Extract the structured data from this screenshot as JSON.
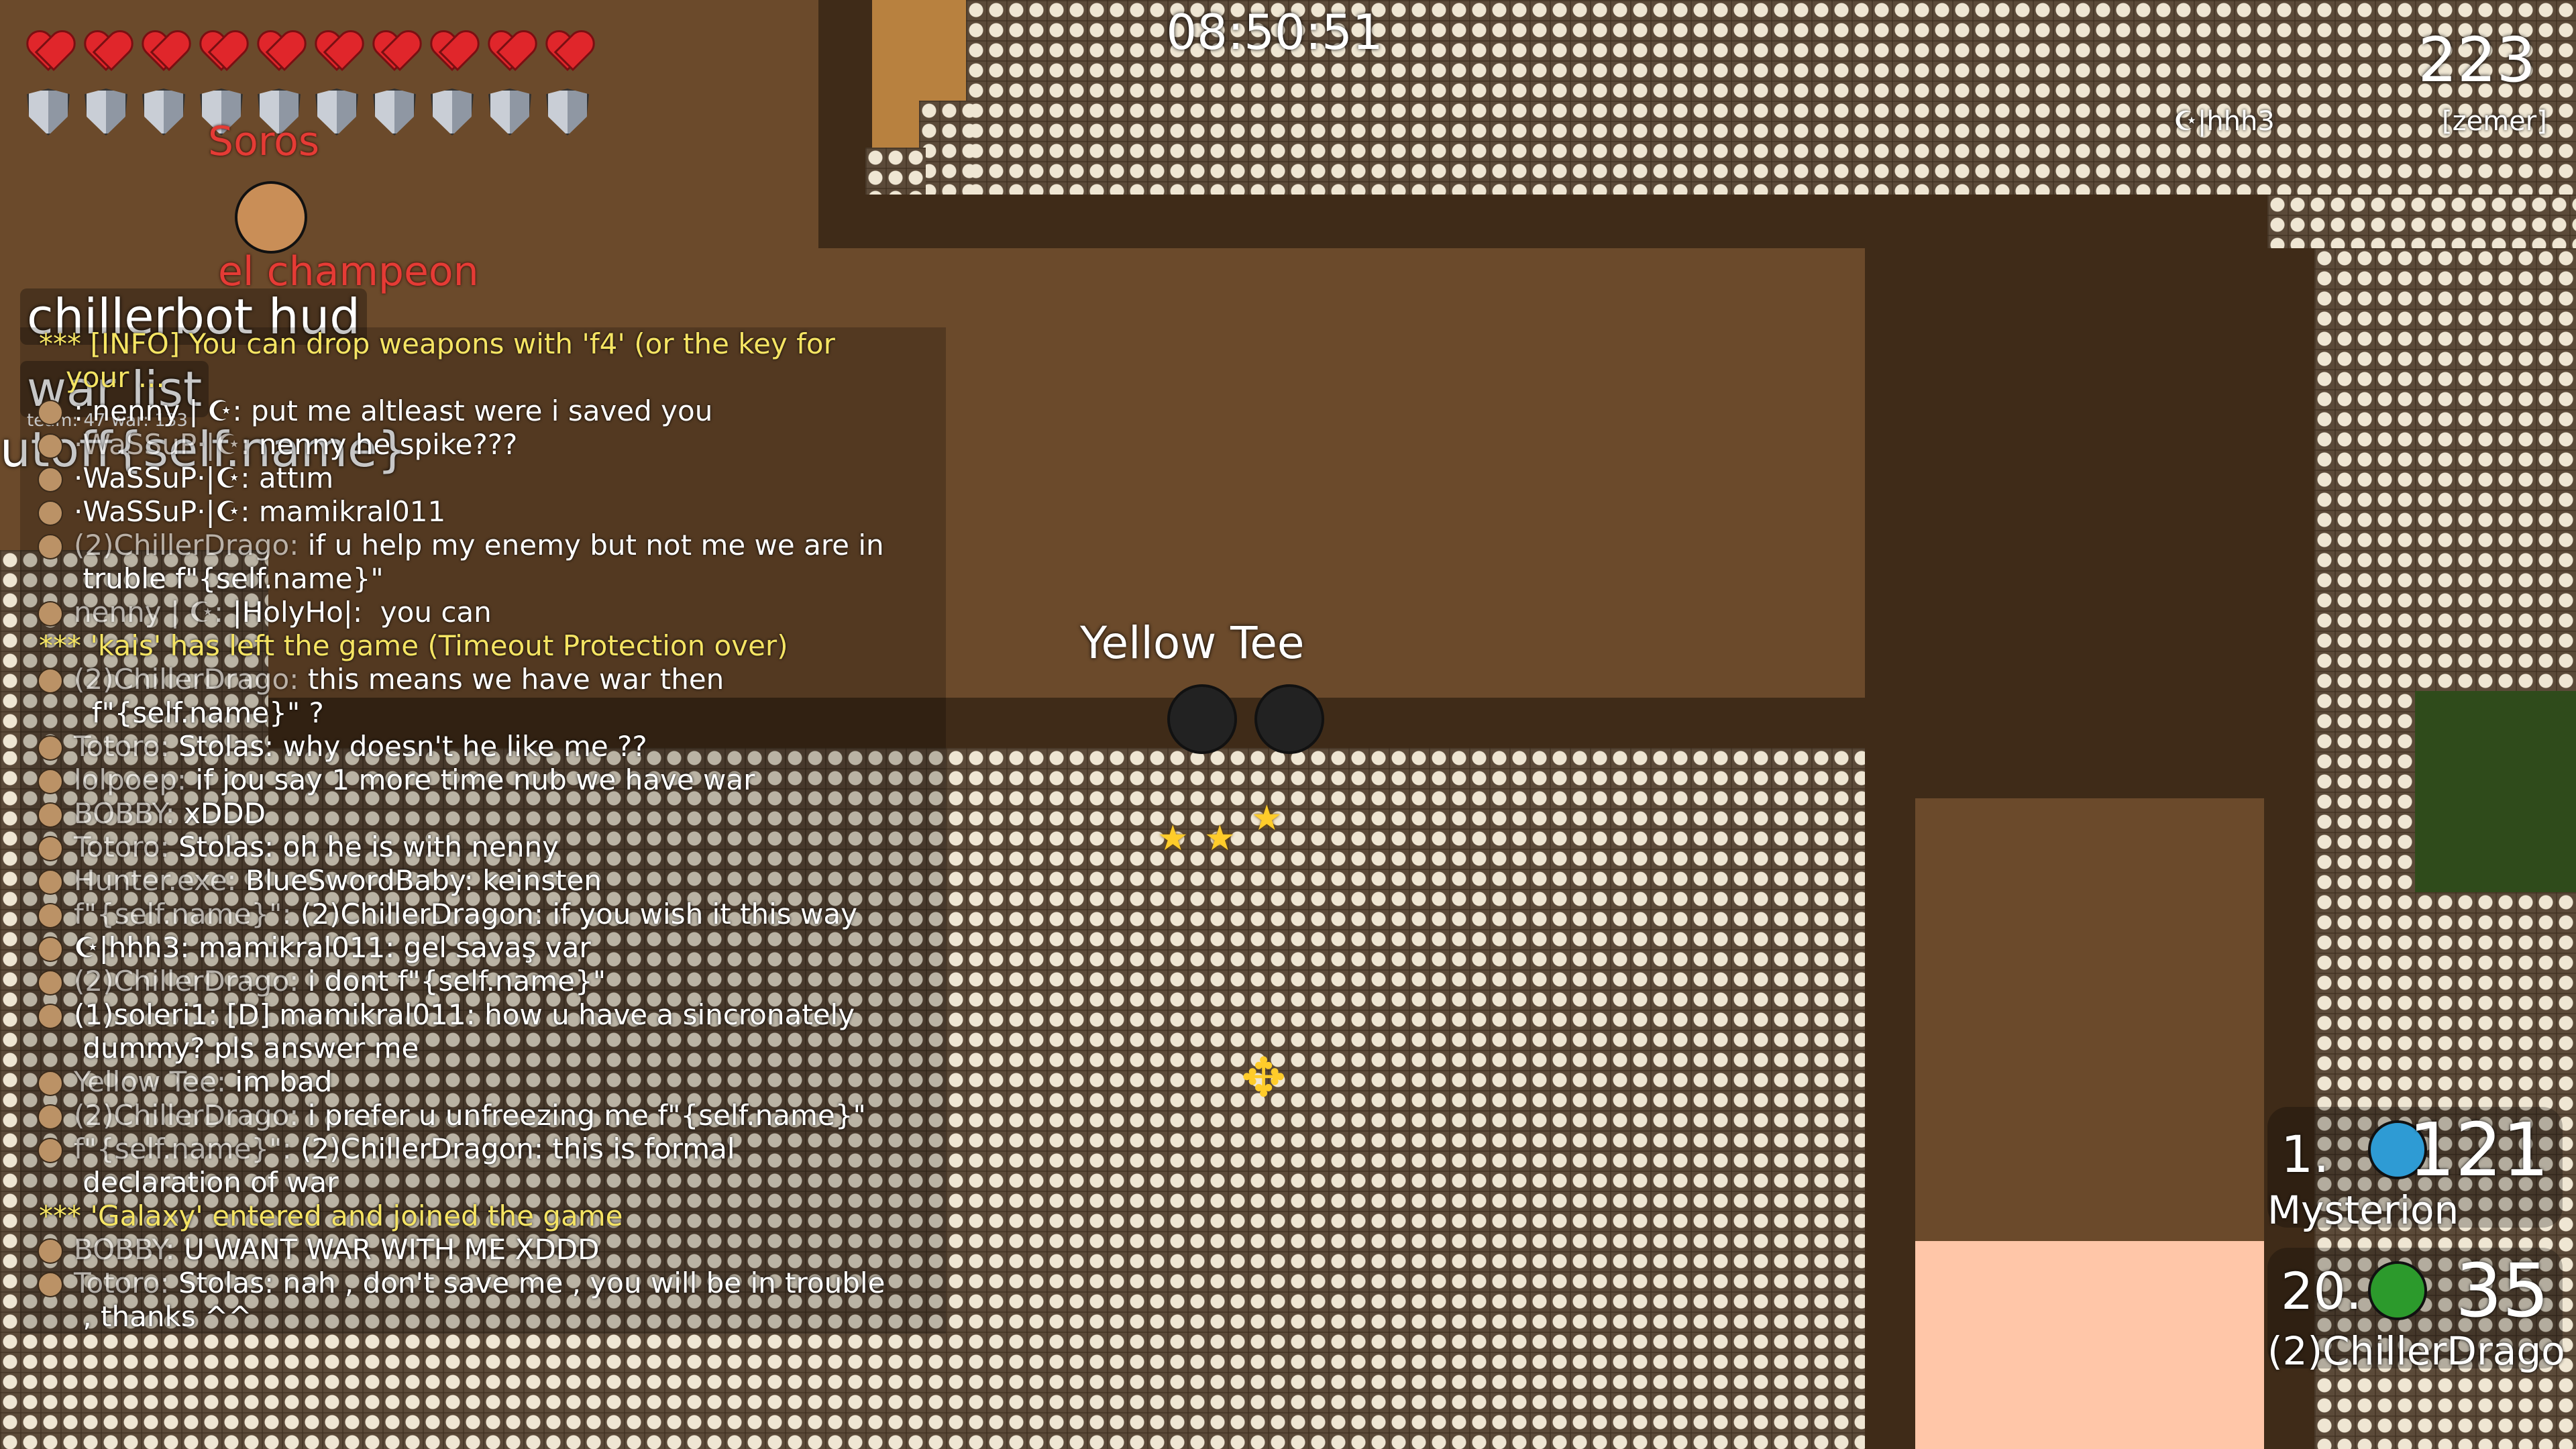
{
  "hud": {
    "health": 10,
    "armor": 10,
    "clock": "08:50:51",
    "top_score": "223",
    "top_players": [
      "☪|hhh3",
      "[zemer]"
    ]
  },
  "world_labels": {
    "player_top": "Soros",
    "player_second": "el champeon",
    "overlay_hud": "chillerbot hud",
    "overlay_war": "war list",
    "overlay_team": "team: 47 war: 133",
    "overlay_self": "utoff{self.name}",
    "center_name": "Yellow Tee"
  },
  "chat": [
    {
      "type": "sys",
      "text": "*** [INFO] You can drop weapons with 'f4' (or the key for",
      "cont": "your ..."
    },
    {
      "type": "msg",
      "name": "",
      "text": ": nenny | ☪: put me altleast were i saved you"
    },
    {
      "type": "msg",
      "name": "·WaSSuP·|☪:",
      "text": "nenny he spike???"
    },
    {
      "type": "msg",
      "name": "",
      "text": "·WaSSuP·|☪: attım"
    },
    {
      "type": "msg",
      "name": "",
      "text": "·WaSSuP·|☪: mamikral011"
    },
    {
      "type": "msg",
      "name": "(2)ChillerDrago:",
      "text": "if u help my enemy but not me we are in\n truble f\"{self.name}\""
    },
    {
      "type": "msg",
      "name": "nenny | ☪:",
      "text": "|HolyHo|:  you can"
    },
    {
      "type": "sys",
      "text": "*** 'kais' has left the game (Timeout Protection over)"
    },
    {
      "type": "msg",
      "name": "(2)ChillerDrago:",
      "text": "this means we have war then\n  f\"{self.name}\" ?"
    },
    {
      "type": "msg",
      "name": "Totoro:",
      "text": "Stolas: why doesn't he like me ??"
    },
    {
      "type": "msg",
      "name": "lolpoep:",
      "text": "if jou say 1 more time nub we have war"
    },
    {
      "type": "msg",
      "name": "BOBBY:",
      "text": "xDDD"
    },
    {
      "type": "msg",
      "name": "Totoro:",
      "text": "Stolas: oh he is with nenny"
    },
    {
      "type": "msg",
      "name": "Hunter.exe:",
      "text": "BlueSwordBaby: keinsten"
    },
    {
      "type": "msg",
      "name": "f\"{self.name}\":",
      "text": "(2)ChillerDragon: if you wish it this way"
    },
    {
      "type": "msg",
      "name": "",
      "text": "☪|hhh3: mamikral011: gel savaş var"
    },
    {
      "type": "msg",
      "name": "(2)ChillerDrago:",
      "text": "i dont f\"{self.name}\""
    },
    {
      "type": "msg",
      "name": "",
      "text": "(1)soleri1: [D] mamikral011: how u have a sincronately\n dummy? pls answer me"
    },
    {
      "type": "msg",
      "name": "Yellow Tee:",
      "text": "im bad"
    },
    {
      "type": "msg",
      "name": "(2)ChillerDrago:",
      "text": "i prefer u unfreezing me f\"{self.name}\""
    },
    {
      "type": "msg",
      "name": "f\"{self.name}\":",
      "text": "(2)ChillerDragon: this is formal\n declaration of war"
    },
    {
      "type": "sys",
      "text": "*** 'Galaxy' entered and joined the game"
    },
    {
      "type": "msg",
      "name": "BOBBY:",
      "text": "U WANT WAR WITH ME XDDD"
    },
    {
      "type": "msg",
      "name": "Totoro:",
      "text": "Stolas: nah , don't save me , you will be in trouble\n , thanks ^^"
    }
  ],
  "scoreboard": [
    {
      "rank": "1.",
      "points": "121",
      "name": "Mysterion"
    },
    {
      "rank": "20.",
      "points": "35",
      "name": "(2)ChillerDrago"
    }
  ],
  "colors": {
    "tile": "#c9b79a",
    "dirt": "#6b4a2b",
    "dark": "#3f2b18",
    "peach": "#ffc6a8"
  }
}
